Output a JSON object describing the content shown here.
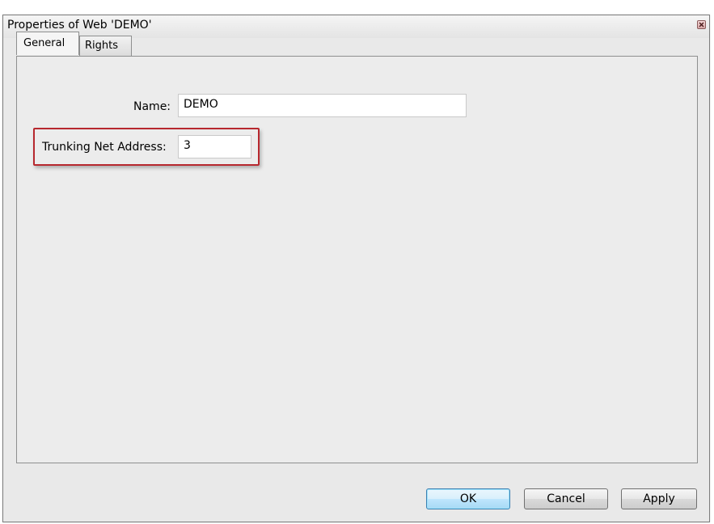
{
  "window": {
    "title": "Properties of Web 'DEMO'",
    "close_icon": "close-icon"
  },
  "tabs": [
    {
      "label": "General",
      "selected": true
    },
    {
      "label": "Rights",
      "selected": false
    }
  ],
  "form": {
    "name_label": "Name:",
    "name_value": "DEMO",
    "trunking_label": "Trunking Net Address:",
    "trunking_value": "3"
  },
  "buttons": {
    "ok": "OK",
    "cancel": "Cancel",
    "apply": "Apply"
  },
  "colors": {
    "highlight": "#b7282e",
    "default_button": "#3c7fb1"
  }
}
